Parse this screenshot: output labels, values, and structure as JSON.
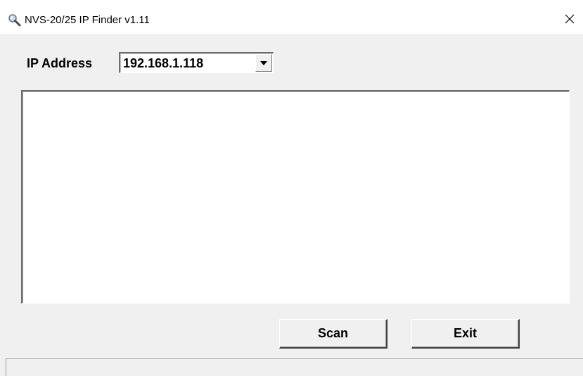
{
  "window": {
    "title": "NVS-20/25 IP Finder v1.11",
    "title_icon": "magnifier-icon",
    "close_icon": "close-icon"
  },
  "form": {
    "ip_label": "IP Address",
    "ip_value": "192.168.1.118",
    "dropdown_icon": "dropdown-arrow-icon"
  },
  "results": {
    "items": []
  },
  "buttons": {
    "scan_label": "Scan",
    "exit_label": "Exit"
  },
  "status": {
    "text": ""
  },
  "colors": {
    "client_background": "#f0f0f0",
    "titlebar_background": "#ffffff",
    "field_background": "#ffffff"
  }
}
